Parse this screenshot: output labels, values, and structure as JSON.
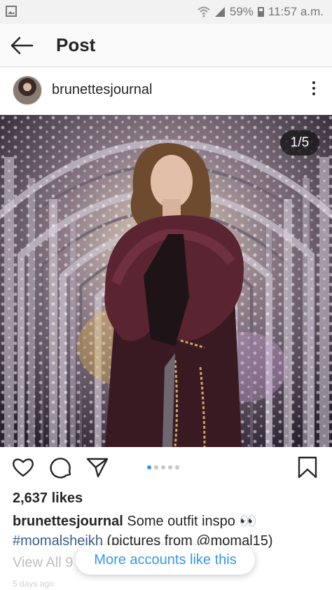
{
  "status_bar": {
    "battery": "59%",
    "time": "11:57 a.m.",
    "icons": [
      "gallery-icon",
      "wifi-icon",
      "signal-icon",
      "battery-icon"
    ]
  },
  "app_bar": {
    "title": "Post",
    "back_icon": "arrow-left-icon"
  },
  "post": {
    "username": "brunettesjournal",
    "image_counter": "1/5",
    "likes": "2,637 likes",
    "caption": {
      "username": "brunettesjournal",
      "text": "Some outfit inspo 👀",
      "hashtag": "#momalsheikh",
      "rest": "(pictures from @momal15)"
    },
    "view_all": "View All 9",
    "time_ago": "5 days ago",
    "carousel": {
      "count": 5,
      "active_index": 0
    }
  },
  "suggestion_pill": "More accounts like this",
  "colors": {
    "accent": "#3897f0",
    "text": "#262626",
    "hashtag": "#3b5e8c"
  }
}
